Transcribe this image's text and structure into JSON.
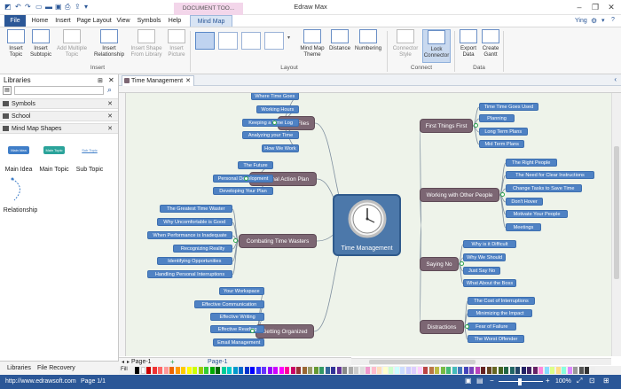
{
  "window": {
    "title": "Edraw Max",
    "user": "Ying",
    "context_tab_label": "DOCUMENT TOO..."
  },
  "menu": {
    "tabs": [
      "File",
      "Home",
      "Insert",
      "Page Layout",
      "View",
      "Symbols",
      "Help",
      "Mind Map"
    ]
  },
  "ribbon": {
    "insert": {
      "insert_topic": "Insert\nTopic",
      "insert_subtopic": "Insert\nSubtopic",
      "add_multiple_topic": "Add Multiple\nTopic",
      "insert_relationship": "Insert\nRelationship",
      "insert_shape_from_library": "Insert Shape\nFrom Library",
      "insert_picture": "Insert\nPicture",
      "group_label": "Insert"
    },
    "layout": {
      "mind_map_theme": "Mind Map\nTheme",
      "distance": "Distance",
      "numbering": "Numbering",
      "group_label": "Layout"
    },
    "connect": {
      "connector_style": "Connector\nStyle",
      "lock_connector": "Lock\nConnector",
      "group_label": "Connect"
    },
    "data": {
      "export_data": "Export\nData",
      "create_gantt": "Create\nGantt",
      "group_label": "Data"
    }
  },
  "left_panel": {
    "title": "Libraries",
    "items": [
      "Symbols",
      "School",
      "Mind Map Shapes"
    ],
    "shapes": {
      "main_idea_pill": "Main Idea",
      "main_topic_pill": "Main Topic",
      "sub_topic_pill": "Sub Topic",
      "main_idea": "Main Idea",
      "main_topic": "Main Topic",
      "sub_topic": "Sub Topic",
      "relationship": "Relationship"
    },
    "bottom_tabs": [
      "Libraries",
      "File Recovery"
    ]
  },
  "document": {
    "tab": "Time Management",
    "page_tab_left": "Page-1",
    "page_tab_right": "Page-1"
  },
  "mindmap": {
    "central": "Time Management",
    "topics": {
      "time_flies": {
        "label": "Time Flies",
        "subs": [
          "Where Time Goes",
          "Working Hours",
          "Keeping a Time Log",
          "Analyzing your Time",
          "How We Work"
        ]
      },
      "personal_action_plan": {
        "label": "Personal Action Plan",
        "subs": [
          "The Future",
          "Personal Development",
          "Developing Your Plan"
        ]
      },
      "combating_time_wasters": {
        "label": "Combating Time Wasters",
        "subs": [
          "The Greatest Time Waster",
          "Why Uncomfortable is Good",
          "When Performance is Inadequate",
          "Recognizing Reality",
          "Identifying Opportunities",
          "Handling Personal Interruptions"
        ]
      },
      "getting_organized": {
        "label": "Getting Organized",
        "subs": [
          "Your Workspace",
          "Effective Communication",
          "Effective Writing",
          "Effective Reading",
          "Email Management"
        ]
      },
      "first_things_first": {
        "label": "First Things First",
        "subs": [
          "Time Time Goes Used",
          "Planning",
          "Long Term Plans",
          "Mid Term Plans"
        ]
      },
      "working_with_other_people": {
        "label": "Working with Other People",
        "subs": [
          "The Right People",
          "The Need for Clear Instructions",
          "Change Tasks to Save Time",
          "Don't Hover",
          "Motivate Your People",
          "Meetings"
        ]
      },
      "saying_no": {
        "label": "Saying No",
        "subs": [
          "Why is it Difficult",
          "Why We Should",
          "Just Say No",
          "What About the Boss"
        ]
      },
      "distractions": {
        "label": "Distractions",
        "subs": [
          "The Cost of Interruptions",
          "Minimizing the Impact",
          "Fear of Failure",
          "The Worst Offender"
        ]
      }
    }
  },
  "status": {
    "url": "http://www.edrawsoft.com",
    "page": "Page 1/1",
    "zoom": "100%",
    "fill_label": "Fill"
  }
}
